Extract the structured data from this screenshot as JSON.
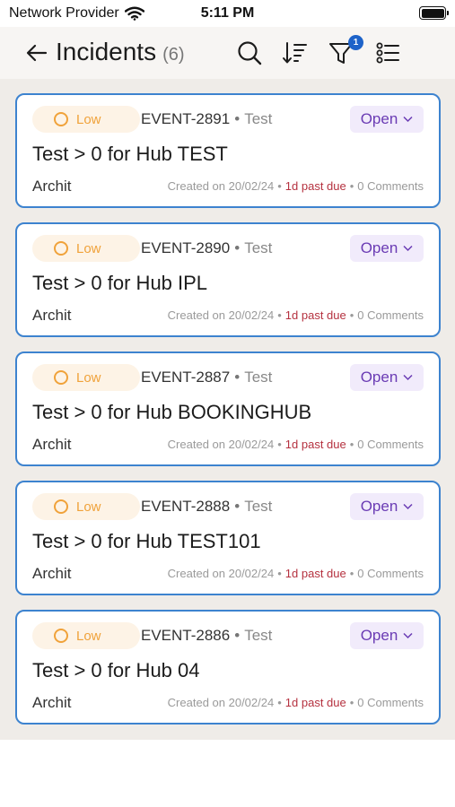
{
  "status_bar": {
    "carrier": "Network Provider",
    "time": "5:11 PM"
  },
  "header": {
    "title": "Incidents",
    "count": "(6)",
    "filter_badge": "1"
  },
  "incidents": [
    {
      "severity": "Low",
      "event_id": "EVENT-2891",
      "event_type": "Test",
      "status": "Open",
      "title": "Test > 0 for Hub TEST",
      "owner": "Archit",
      "created": "Created on 20/02/24",
      "due": "1d past due",
      "comments": "0 Comments"
    },
    {
      "severity": "Low",
      "event_id": "EVENT-2890",
      "event_type": "Test",
      "status": "Open",
      "title": "Test > 0 for Hub IPL",
      "owner": "Archit",
      "created": "Created on 20/02/24",
      "due": "1d past due",
      "comments": "0 Comments"
    },
    {
      "severity": "Low",
      "event_id": "EVENT-2887",
      "event_type": "Test",
      "status": "Open",
      "title": "Test > 0 for Hub BOOKINGHUB",
      "owner": "Archit",
      "created": "Created on 20/02/24",
      "due": "1d past due",
      "comments": "0 Comments"
    },
    {
      "severity": "Low",
      "event_id": "EVENT-2888",
      "event_type": "Test",
      "status": "Open",
      "title": "Test > 0 for Hub TEST101",
      "owner": "Archit",
      "created": "Created on 20/02/24",
      "due": "1d past due",
      "comments": "0 Comments"
    },
    {
      "severity": "Low",
      "event_id": "EVENT-2886",
      "event_type": "Test",
      "status": "Open",
      "title": "Test > 0 for Hub 04",
      "owner": "Archit",
      "created": "Created on 20/02/24",
      "due": "1d past due",
      "comments": "0 Comments"
    }
  ],
  "colors": {
    "card_border": "#3d83cf",
    "severity_low": "#f0a23a",
    "status_open": "#6a3bb4",
    "past_due": "#b5313f",
    "badge": "#1e63c9"
  },
  "icons": [
    "back-arrow-icon",
    "search-icon",
    "sort-icon",
    "filter-icon",
    "list-options-icon",
    "severity-circle-icon",
    "chevron-down-icon",
    "wifi-icon",
    "battery-icon"
  ]
}
